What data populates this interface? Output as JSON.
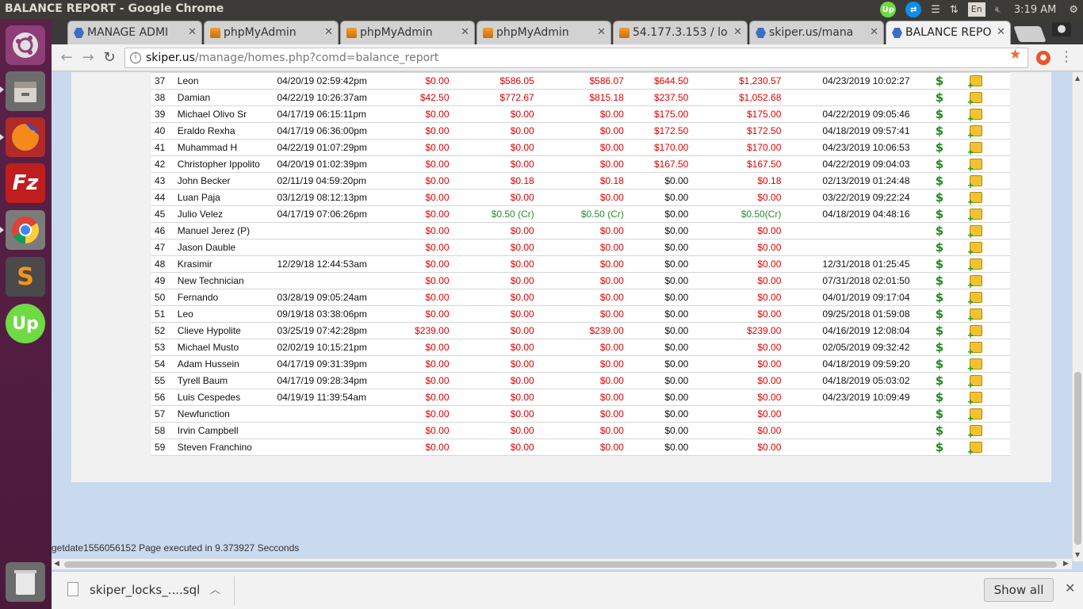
{
  "top_panel": {
    "window_title": "BALANCE REPORT - Google Chrome",
    "tray": {
      "upwork": "Up",
      "keyboard": "En",
      "clock": "3:19 AM"
    }
  },
  "tabs": [
    {
      "label": "MANAGE ADMI",
      "favicon": "hex-icon"
    },
    {
      "label": "phpMyAdmin",
      "favicon": "pma-icon"
    },
    {
      "label": "phpMyAdmin",
      "favicon": "pma-icon"
    },
    {
      "label": "phpMyAdmin",
      "favicon": "pma-icon"
    },
    {
      "label": "54.177.3.153 / lo",
      "favicon": "pma-icon"
    },
    {
      "label": "skiper.us/mana",
      "favicon": "hex-icon"
    },
    {
      "label": "BALANCE REPO",
      "favicon": "hex-icon",
      "active": true
    }
  ],
  "address_bar": {
    "host": "skiper.us",
    "path": "/manage/homes.php?comd=balance_report"
  },
  "report": {
    "rows": [
      {
        "num": "37",
        "name": "Leon",
        "date": "04/20/19 02:59:42pm",
        "a1": "$0.00",
        "a2": "$586.05",
        "a3": "$586.07",
        "a4": "$644.50",
        "a5": "$1,230.57",
        "end": "04/23/2019 10:02:27"
      },
      {
        "num": "38",
        "name": "Damian",
        "date": "04/22/19 10:26:37am",
        "a1": "$42.50",
        "a2": "$772.67",
        "a3": "$815.18",
        "a4": "$237.50",
        "a5": "$1,052.68",
        "end": ""
      },
      {
        "num": "39",
        "name": "Michael Olivo Sr",
        "date": "04/17/19 06:15:11pm",
        "a1": "$0.00",
        "a2": "$0.00",
        "a3": "$0.00",
        "a4": "$175.00",
        "a5": "$175.00",
        "end": "04/22/2019 09:05:46"
      },
      {
        "num": "40",
        "name": "Eraldo Rexha",
        "date": "04/17/19 06:36:00pm",
        "a1": "$0.00",
        "a2": "$0.00",
        "a3": "$0.00",
        "a4": "$172.50",
        "a5": "$172.50",
        "end": "04/18/2019 09:57:41"
      },
      {
        "num": "41",
        "name": "Muhammad H",
        "date": "04/22/19 01:07:29pm",
        "a1": "$0.00",
        "a2": "$0.00",
        "a3": "$0.00",
        "a4": "$170.00",
        "a5": "$170.00",
        "end": "04/23/2019 10:06:53"
      },
      {
        "num": "42",
        "name": "Christopher Ippolito",
        "date": "04/20/19 01:02:39pm",
        "a1": "$0.00",
        "a2": "$0.00",
        "a3": "$0.00",
        "a4": "$167.50",
        "a5": "$167.50",
        "end": "04/22/2019 09:04:03"
      },
      {
        "num": "43",
        "name": "John Becker",
        "date": "02/11/19 04:59:20pm",
        "a1": "$0.00",
        "a2": "$0.18",
        "a3": "$0.18",
        "a4": "$0.00",
        "a5": "$0.18",
        "end": "02/13/2019 01:24:48"
      },
      {
        "num": "44",
        "name": "Luan Paja",
        "date": "03/12/19 08:12:13pm",
        "a1": "$0.00",
        "a2": "$0.00",
        "a3": "$0.00",
        "a4": "$0.00",
        "a5": "$0.00",
        "end": "03/22/2019 09:22:24"
      },
      {
        "num": "45",
        "name": "Julio Velez",
        "date": "04/17/19 07:06:26pm",
        "a1": "$0.00",
        "a2": "$0.50 (Cr)",
        "a3": "$0.50 (Cr)",
        "a4": "$0.00",
        "a5": "$0.50(Cr)",
        "end": "04/18/2019 04:48:16"
      },
      {
        "num": "46",
        "name": "Manuel Jerez (P)",
        "date": "",
        "a1": "$0.00",
        "a2": "$0.00",
        "a3": "$0.00",
        "a4": "$0.00",
        "a5": "$0.00",
        "end": ""
      },
      {
        "num": "47",
        "name": "Jason Dauble",
        "date": "",
        "a1": "$0.00",
        "a2": "$0.00",
        "a3": "$0.00",
        "a4": "$0.00",
        "a5": "$0.00",
        "end": ""
      },
      {
        "num": "48",
        "name": "Krasimir",
        "date": "12/29/18 12:44:53am",
        "a1": "$0.00",
        "a2": "$0.00",
        "a3": "$0.00",
        "a4": "$0.00",
        "a5": "$0.00",
        "end": "12/31/2018 01:25:45"
      },
      {
        "num": "49",
        "name": "New Technician",
        "date": "",
        "a1": "$0.00",
        "a2": "$0.00",
        "a3": "$0.00",
        "a4": "$0.00",
        "a5": "$0.00",
        "end": "07/31/2018 02:01:50"
      },
      {
        "num": "50",
        "name": "Fernando",
        "date": "03/28/19 09:05:24am",
        "a1": "$0.00",
        "a2": "$0.00",
        "a3": "$0.00",
        "a4": "$0.00",
        "a5": "$0.00",
        "end": "04/01/2019 09:17:04"
      },
      {
        "num": "51",
        "name": "Leo",
        "date": "09/19/18 03:38:06pm",
        "a1": "$0.00",
        "a2": "$0.00",
        "a3": "$0.00",
        "a4": "$0.00",
        "a5": "$0.00",
        "end": "09/25/2018 01:59:08"
      },
      {
        "num": "52",
        "name": "Clieve Hypolite",
        "date": "03/25/19 07:42:28pm",
        "a1": "$239.00",
        "a2": "$0.00",
        "a3": "$239.00",
        "a4": "$0.00",
        "a5": "$239.00",
        "end": "04/16/2019 12:08:04"
      },
      {
        "num": "53",
        "name": "Michael Musto",
        "date": "02/02/19 10:15:21pm",
        "a1": "$0.00",
        "a2": "$0.00",
        "a3": "$0.00",
        "a4": "$0.00",
        "a5": "$0.00",
        "end": "02/05/2019 09:32:42"
      },
      {
        "num": "54",
        "name": "Adam Hussein",
        "date": "04/17/19 09:31:39pm",
        "a1": "$0.00",
        "a2": "$0.00",
        "a3": "$0.00",
        "a4": "$0.00",
        "a5": "$0.00",
        "end": "04/18/2019 09:59:20"
      },
      {
        "num": "55",
        "name": "Tyrell Baum",
        "date": "04/17/19 09:28:34pm",
        "a1": "$0.00",
        "a2": "$0.00",
        "a3": "$0.00",
        "a4": "$0.00",
        "a5": "$0.00",
        "end": "04/18/2019 05:03:02"
      },
      {
        "num": "56",
        "name": "Luis Cespedes",
        "date": "04/19/19 11:39:54am",
        "a1": "$0.00",
        "a2": "$0.00",
        "a3": "$0.00",
        "a4": "$0.00",
        "a5": "$0.00",
        "end": "04/23/2019 10:09:49"
      },
      {
        "num": "57",
        "name": "Newfunction",
        "date": "",
        "a1": "$0.00",
        "a2": "$0.00",
        "a3": "$0.00",
        "a4": "$0.00",
        "a5": "$0.00",
        "end": ""
      },
      {
        "num": "58",
        "name": "Irvin Campbell",
        "date": "",
        "a1": "$0.00",
        "a2": "$0.00",
        "a3": "$0.00",
        "a4": "$0.00",
        "a5": "$0.00",
        "end": ""
      },
      {
        "num": "59",
        "name": "Steven Franchino",
        "date": "",
        "a1": "$0.00",
        "a2": "$0.00",
        "a3": "$0.00",
        "a4": "$0.00",
        "a5": "$0.00",
        "end": ""
      }
    ],
    "dollar_symbol": "$"
  },
  "status": "getdate1556056152 Page executed in 9.373927 Secconds",
  "downloads": {
    "file_name": "skiper_locks_....sql",
    "show_all": "Show all"
  },
  "colors": {
    "negative": "#e00000",
    "credit": "#2a8a2a",
    "highlight_row": "#d99a9a"
  }
}
